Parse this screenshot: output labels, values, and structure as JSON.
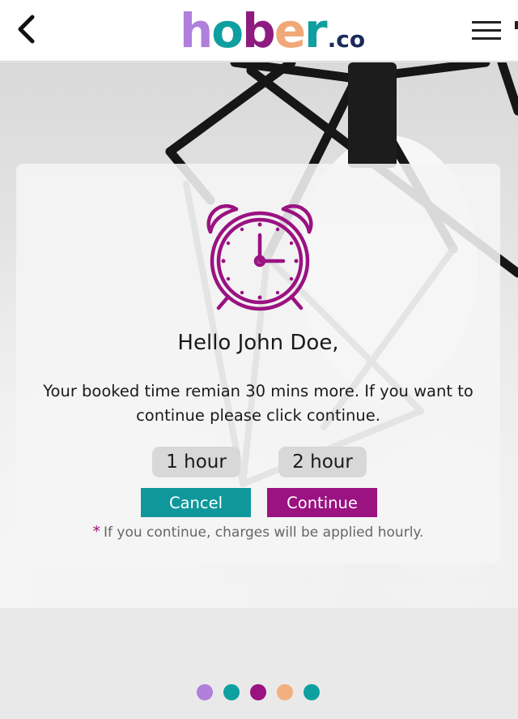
{
  "header": {
    "logo_letters": [
      {
        "char": "h",
        "color": "#b07fdc"
      },
      {
        "char": "o",
        "color": "#0f9fa0"
      },
      {
        "char": "b",
        "color": "#8e1c7f"
      },
      {
        "char": "e",
        "color": "#f0a878"
      },
      {
        "char": "r",
        "color": "#0f9fa0"
      }
    ],
    "logo_suffix": ".co",
    "logo_suffix_color": "#1a2a5a",
    "back_icon": "chevron-left-icon",
    "menu_icon": "hamburger-menu-icon"
  },
  "modal": {
    "icon": "alarm-clock-icon",
    "icon_color": "#9b1281",
    "greeting": "Hello John Doe,",
    "message_line1": "Your booked time remian 30 mins more. If you want to",
    "message_line2": "continue please click continue.",
    "hour_options": [
      "1 hour",
      "2 hour"
    ],
    "cancel_label": "Cancel",
    "continue_label": "Continue",
    "note_star": "*",
    "note_text": "If you continue, charges will be applied hourly."
  },
  "colors": {
    "teal": "#0f989c",
    "purple": "#9b1281"
  },
  "carousel": {
    "dot_colors": [
      "#b07fdc",
      "#0f9fa0",
      "#9b1281",
      "#f2b07e",
      "#0f9fa0"
    ]
  }
}
